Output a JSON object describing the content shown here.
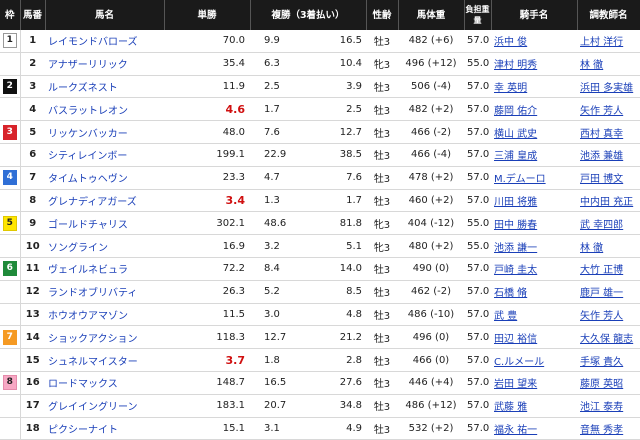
{
  "headers": {
    "waku": "枠",
    "umaban": "馬番",
    "name": "馬名",
    "tansho": "単勝",
    "fukusho": "複勝（3着払い）",
    "sexage": "性齢",
    "weight": "馬体重",
    "kinryo": "負担重量",
    "jockey": "騎手名",
    "trainer": "調教師名"
  },
  "waku_colors": {
    "1": {
      "bg": "#ffffff",
      "fg": "#222222",
      "border": "#999999"
    },
    "2": {
      "bg": "#111111",
      "fg": "#ffffff",
      "border": "#111111"
    },
    "3": {
      "bg": "#d8232a",
      "fg": "#ffffff",
      "border": "#d8232a"
    },
    "4": {
      "bg": "#2f6fd6",
      "fg": "#ffffff",
      "border": "#2f6fd6"
    },
    "5": {
      "bg": "#ffe600",
      "fg": "#222222",
      "border": "#e0c800"
    },
    "6": {
      "bg": "#1f8a3a",
      "fg": "#ffffff",
      "border": "#1f8a3a"
    },
    "7": {
      "bg": "#f59a23",
      "fg": "#ffffff",
      "border": "#f59a23"
    },
    "8": {
      "bg": "#f7a8c4",
      "fg": "#222222",
      "border": "#e58bab"
    }
  },
  "rows": [
    {
      "waku": "1",
      "num": "1",
      "name": "レイモンドバローズ",
      "odds": "70.0",
      "fav": false,
      "plo": "9.9",
      "plh": "16.5",
      "sa": "牡3",
      "wt": "482 (+6)",
      "kin": "57.0",
      "jockey": "浜中 俊",
      "trainer": "上村 洋行"
    },
    {
      "waku": "",
      "num": "2",
      "name": "アナザーリリック",
      "odds": "35.4",
      "fav": false,
      "plo": "6.3",
      "plh": "10.4",
      "sa": "牝3",
      "wt": "496 (+12)",
      "kin": "55.0",
      "jockey": "津村 明秀",
      "trainer": "林 徹"
    },
    {
      "waku": "2",
      "num": "3",
      "name": "ルークズネスト",
      "odds": "11.9",
      "fav": false,
      "plo": "2.5",
      "plh": "3.9",
      "sa": "牡3",
      "wt": "506 (-4)",
      "kin": "57.0",
      "jockey": "幸 英明",
      "trainer": "浜田 多実雄"
    },
    {
      "waku": "",
      "num": "4",
      "name": "バスラットレオン",
      "odds": "4.6",
      "fav": true,
      "plo": "1.7",
      "plh": "2.5",
      "sa": "牡3",
      "wt": "482 (+2)",
      "kin": "57.0",
      "jockey": "藤岡 佑介",
      "trainer": "矢作 芳人"
    },
    {
      "waku": "3",
      "num": "5",
      "name": "リッケンバッカー",
      "odds": "48.0",
      "fav": false,
      "plo": "7.6",
      "plh": "12.7",
      "sa": "牡3",
      "wt": "466 (-2)",
      "kin": "57.0",
      "jockey": "横山 武史",
      "trainer": "西村 真幸"
    },
    {
      "waku": "",
      "num": "6",
      "name": "シティレインボー",
      "odds": "199.1",
      "fav": false,
      "plo": "22.9",
      "plh": "38.5",
      "sa": "牡3",
      "wt": "466 (-4)",
      "kin": "57.0",
      "jockey": "三浦 皇成",
      "trainer": "池添 兼雄"
    },
    {
      "waku": "4",
      "num": "7",
      "name": "タイムトゥヘヴン",
      "odds": "23.3",
      "fav": false,
      "plo": "4.7",
      "plh": "7.6",
      "sa": "牡3",
      "wt": "478 (+2)",
      "kin": "57.0",
      "jockey": "M.デムーロ",
      "trainer": "戸田 博文"
    },
    {
      "waku": "",
      "num": "8",
      "name": "グレナディアガーズ",
      "odds": "3.4",
      "fav": true,
      "plo": "1.3",
      "plh": "1.7",
      "sa": "牡3",
      "wt": "460 (+2)",
      "kin": "57.0",
      "jockey": "川田 将雅",
      "trainer": "中内田 充正"
    },
    {
      "waku": "5",
      "num": "9",
      "name": "ゴールドチャリス",
      "odds": "302.1",
      "fav": false,
      "plo": "48.6",
      "plh": "81.8",
      "sa": "牝3",
      "wt": "404 (-12)",
      "kin": "55.0",
      "jockey": "田中 勝春",
      "trainer": "武 幸四郎"
    },
    {
      "waku": "",
      "num": "10",
      "name": "ソングライン",
      "odds": "16.9",
      "fav": false,
      "plo": "3.2",
      "plh": "5.1",
      "sa": "牝3",
      "wt": "480 (+2)",
      "kin": "55.0",
      "jockey": "池添 謙一",
      "trainer": "林 徹"
    },
    {
      "waku": "6",
      "num": "11",
      "name": "ヴェイルネビュラ",
      "odds": "72.2",
      "fav": false,
      "plo": "8.4",
      "plh": "14.0",
      "sa": "牡3",
      "wt": "490 (0)",
      "kin": "57.0",
      "jockey": "戸崎 圭太",
      "trainer": "大竹 正博"
    },
    {
      "waku": "",
      "num": "12",
      "name": "ランドオブリバティ",
      "odds": "26.3",
      "fav": false,
      "plo": "5.2",
      "plh": "8.5",
      "sa": "牡3",
      "wt": "462 (-2)",
      "kin": "57.0",
      "jockey": "石橋 脩",
      "trainer": "鹿戸 雄一"
    },
    {
      "waku": "",
      "num": "13",
      "name": "ホウオウアマゾン",
      "odds": "11.5",
      "fav": false,
      "plo": "3.0",
      "plh": "4.8",
      "sa": "牡3",
      "wt": "486 (-10)",
      "kin": "57.0",
      "jockey": "武 豊",
      "trainer": "矢作 芳人"
    },
    {
      "waku": "7",
      "num": "14",
      "name": "ショックアクション",
      "odds": "118.3",
      "fav": false,
      "plo": "12.7",
      "plh": "21.2",
      "sa": "牡3",
      "wt": "496 (0)",
      "kin": "57.0",
      "jockey": "田辺 裕信",
      "trainer": "大久保 龍志"
    },
    {
      "waku": "",
      "num": "15",
      "name": "シュネルマイスター",
      "odds": "3.7",
      "fav": true,
      "plo": "1.8",
      "plh": "2.8",
      "sa": "牡3",
      "wt": "466 (0)",
      "kin": "57.0",
      "jockey": "C.ルメール",
      "trainer": "手塚 貴久"
    },
    {
      "waku": "8",
      "num": "16",
      "name": "ロードマックス",
      "odds": "148.7",
      "fav": false,
      "plo": "16.5",
      "plh": "27.6",
      "sa": "牡3",
      "wt": "446 (+4)",
      "kin": "57.0",
      "jockey": "岩田 望来",
      "trainer": "藤原 英昭"
    },
    {
      "waku": "",
      "num": "17",
      "name": "グレイイングリーン",
      "odds": "183.1",
      "fav": false,
      "plo": "20.7",
      "plh": "34.8",
      "sa": "牡3",
      "wt": "486 (+12)",
      "kin": "57.0",
      "jockey": "武藤 雅",
      "trainer": "池江 泰寿"
    },
    {
      "waku": "",
      "num": "18",
      "name": "ピクシーナイト",
      "odds": "15.1",
      "fav": false,
      "plo": "3.1",
      "plh": "4.9",
      "sa": "牡3",
      "wt": "532 (+2)",
      "kin": "57.0",
      "jockey": "福永 祐一",
      "trainer": "音無 秀孝"
    }
  ]
}
